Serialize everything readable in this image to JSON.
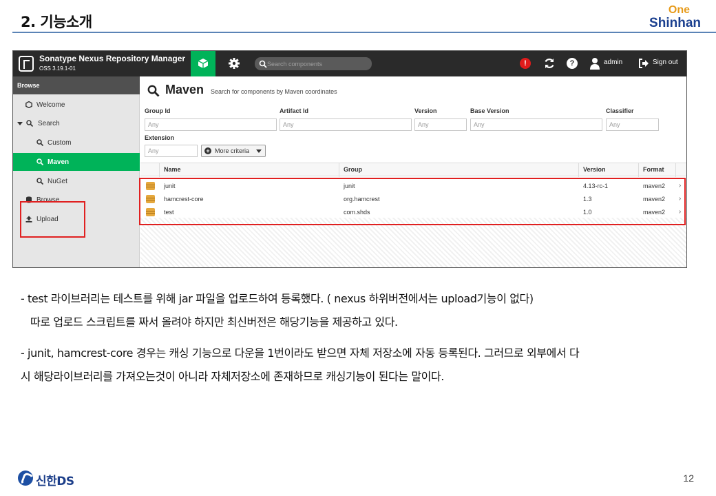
{
  "slide": {
    "title": "2. 기능소개",
    "brand_one": "One",
    "brand_shinhan": "Shinhan",
    "page_number": "12",
    "footer_logo": "신한DS"
  },
  "nexus": {
    "app_name": "Sonatype Nexus Repository Manager",
    "version": "OSS 3.19.1-01",
    "search_placeholder": "Search components",
    "alert_glyph": "!",
    "help_glyph": "?",
    "user": "admin",
    "signout": "Sign out",
    "sidebar": {
      "header": "Browse",
      "items": [
        {
          "label": "Welcome",
          "icon": "hexagon-icon"
        },
        {
          "label": "Search",
          "icon": "search-icon",
          "expanded": true
        },
        {
          "label": "Custom",
          "icon": "search-icon"
        },
        {
          "label": "Maven",
          "icon": "search-icon",
          "active": true
        },
        {
          "label": "NuGet",
          "icon": "search-icon"
        },
        {
          "label": "Browse",
          "icon": "database-icon"
        },
        {
          "label": "Upload",
          "icon": "upload-icon"
        }
      ]
    },
    "main": {
      "title": "Maven",
      "subtitle": "Search for components by Maven coordinates",
      "fields": {
        "group_id": {
          "label": "Group Id",
          "placeholder": "Any"
        },
        "artifact_id": {
          "label": "Artifact Id",
          "placeholder": "Any"
        },
        "version": {
          "label": "Version",
          "placeholder": "Any"
        },
        "base_version": {
          "label": "Base Version",
          "placeholder": "Any"
        },
        "classifier": {
          "label": "Classifier",
          "placeholder": "Any"
        },
        "extension": {
          "label": "Extension",
          "placeholder": "Any"
        }
      },
      "more_criteria": "More criteria",
      "plus_glyph": "+",
      "columns": [
        "Name",
        "Group",
        "Version",
        "Format"
      ],
      "rows": [
        {
          "name": "junit",
          "group": "junit",
          "version": "4.13-rc-1",
          "format": "maven2"
        },
        {
          "name": "hamcrest-core",
          "group": "org.hamcrest",
          "version": "1.3",
          "format": "maven2"
        },
        {
          "name": "test",
          "group": "com.shds",
          "version": "1.0",
          "format": "maven2"
        }
      ],
      "row_chevron": "›"
    }
  },
  "body": {
    "p1_line1": "- test 라이브러리는 테스트를 위해 jar 파일을 업로드하여 등록했다. ( nexus 하위버전에서는 upload기능이 없다)",
    "p1_line2": "따로 업로드 스크립트를 짜서 올려야 하지만 최신버전은 해당기능을 제공하고 있다.",
    "p2_line1": "- junit, hamcrest-core 경우는 캐싱 기능으로 다운을 1번이라도 받으면 자체 저장소에 자동 등록된다. 그러므로 외부에서 다",
    "p2_line2": "시 해당라이브러리를 가져오는것이 아니라 자체저장소에 존재하므로 캐싱기능이 된다는 말이다."
  },
  "colors": {
    "nexus_green": "#00b359",
    "nexus_header": "#2a2a2a",
    "highlight_red": "#e02020",
    "shinhan_blue": "#1a3f8f",
    "one_orange": "#e79b1b"
  }
}
